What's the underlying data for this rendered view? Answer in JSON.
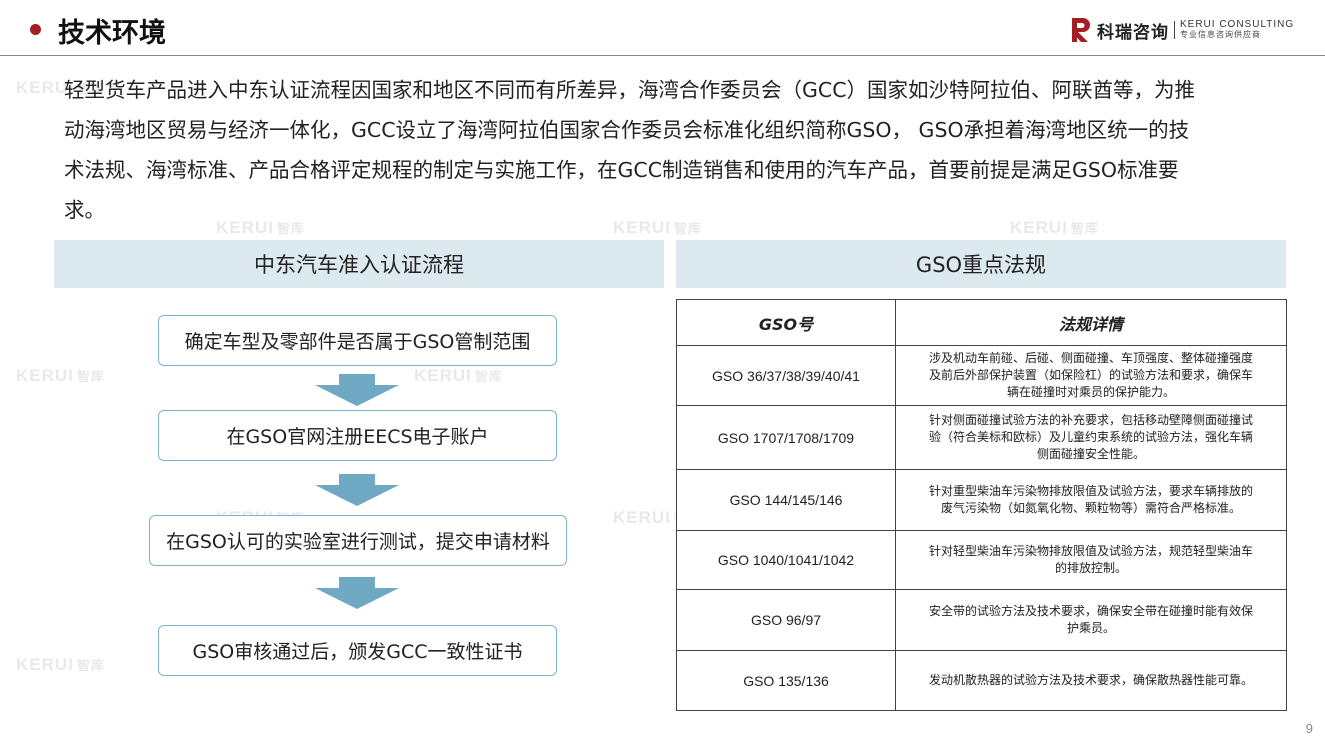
{
  "header": {
    "title": "技术环境",
    "logo": {
      "name": "科瑞咨询",
      "en": "KERUI CONSULTING",
      "cn": "专业信息咨询供应商"
    }
  },
  "watermark": {
    "brand": "KERUI",
    "suffix": "智库"
  },
  "intro_lines": [
    "轻型货车产品进入中东认证流程因国家和地区不同而有所差异，海湾合作委员会（GCC）国家如沙特阿拉伯、阿联酋等，为推",
    "动海湾地区贸易与经济一体化，GCC设立了海湾阿拉伯国家合作委员会标准化组织简称GSO， GSO承担着海湾地区统一的技",
    "术法规、海湾标准、产品合格评定规程的制定与实施工作，在GCC制造销售和使用的汽车产品，首要前提是满足GSO标准要",
    "求。"
  ],
  "flow": {
    "title": "中东汽车准入认证流程",
    "steps": [
      "确定车型及零部件是否属于GSO管制范围",
      "在GSO官网注册EECS电子账户",
      "在GSO认可的实验室进行测试，提交申请材料",
      "GSO审核通过后，颁发GCC一致性证书"
    ]
  },
  "regulations": {
    "title": "GSO重点法规",
    "columns": [
      "GSO号",
      "法规详情"
    ],
    "rows": [
      {
        "num": "GSO 36/37/38/39/40/41",
        "lines": [
          "涉及机动车前碰、后碰、侧面碰撞、车顶强度、整体碰撞强度",
          "及前后外部保护装置（如保险杠）的试验方法和要求，确保车",
          "辆在碰撞时对乘员的保护能力。"
        ]
      },
      {
        "num": "GSO 1707/1708/1709",
        "lines": [
          "针对侧面碰撞试验方法的补充要求，包括移动壁障侧面碰撞试",
          "验（符合美标和欧标）及儿童约束系统的试验方法，强化车辆",
          "侧面碰撞安全性能。"
        ]
      },
      {
        "num": "GSO 144/145/146",
        "lines": [
          "针对重型柴油车污染物排放限值及试验方法，要求车辆排放的",
          "废气污染物（如氮氧化物、颗粒物等）需符合严格标准。"
        ]
      },
      {
        "num": "GSO 1040/1041/1042",
        "lines": [
          "针对轻型柴油车污染物排放限值及试验方法，规范轻型柴油车",
          "的排放控制。"
        ]
      },
      {
        "num": "GSO 96/97",
        "lines": [
          "安全带的试验方法及技术要求，确保安全带在碰撞时能有效保",
          "护乘员。"
        ]
      },
      {
        "num": "GSO 135/136",
        "lines": [
          "发动机散热器的试验方法及技术要求，确保散热器性能可靠。"
        ]
      }
    ]
  },
  "page_number": "9",
  "colors": {
    "accent": "#a31f24",
    "section_bg": "#dce9ee",
    "arrow": "#6fa9c4",
    "box_border": "#7fb3c9"
  }
}
